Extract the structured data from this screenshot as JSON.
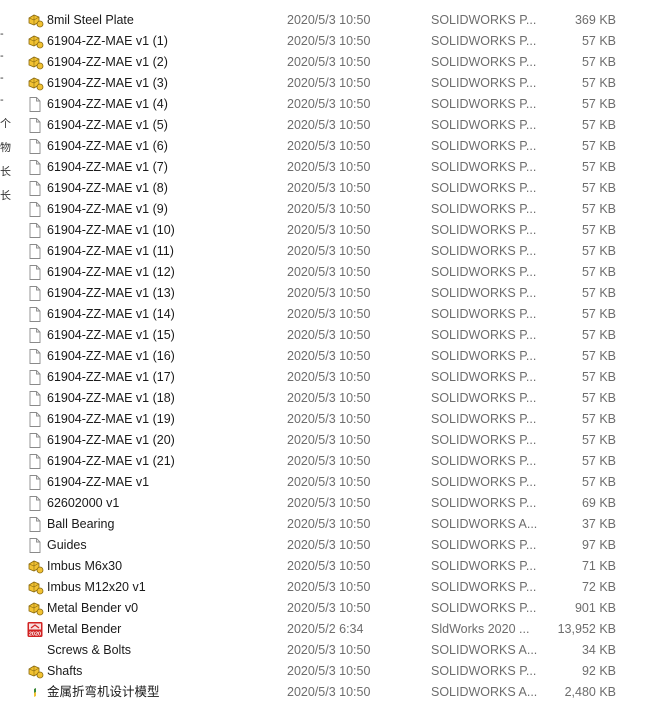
{
  "gutter_marks": [
    "-",
    "-",
    "-",
    "-",
    "个",
    "物",
    "长",
    "长"
  ],
  "files": [
    {
      "icon": "solidworks-assembly-icon",
      "name": "8mil Steel Plate",
      "date": "2020/5/3 10:50",
      "type": "SOLIDWORKS P...",
      "size": "369 KB"
    },
    {
      "icon": "solidworks-assembly-icon",
      "name": "61904-ZZ-MAE v1 (1)",
      "date": "2020/5/3 10:50",
      "type": "SOLIDWORKS P...",
      "size": "57 KB"
    },
    {
      "icon": "solidworks-assembly-icon",
      "name": "61904-ZZ-MAE v1 (2)",
      "date": "2020/5/3 10:50",
      "type": "SOLIDWORKS P...",
      "size": "57 KB"
    },
    {
      "icon": "solidworks-assembly-icon",
      "name": "61904-ZZ-MAE v1 (3)",
      "date": "2020/5/3 10:50",
      "type": "SOLIDWORKS P...",
      "size": "57 KB"
    },
    {
      "icon": "blank-file-icon",
      "name": "61904-ZZ-MAE v1 (4)",
      "date": "2020/5/3 10:50",
      "type": "SOLIDWORKS P...",
      "size": "57 KB"
    },
    {
      "icon": "blank-file-icon",
      "name": "61904-ZZ-MAE v1 (5)",
      "date": "2020/5/3 10:50",
      "type": "SOLIDWORKS P...",
      "size": "57 KB"
    },
    {
      "icon": "blank-file-icon",
      "name": "61904-ZZ-MAE v1 (6)",
      "date": "2020/5/3 10:50",
      "type": "SOLIDWORKS P...",
      "size": "57 KB"
    },
    {
      "icon": "blank-file-icon",
      "name": "61904-ZZ-MAE v1 (7)",
      "date": "2020/5/3 10:50",
      "type": "SOLIDWORKS P...",
      "size": "57 KB"
    },
    {
      "icon": "blank-file-icon",
      "name": "61904-ZZ-MAE v1 (8)",
      "date": "2020/5/3 10:50",
      "type": "SOLIDWORKS P...",
      "size": "57 KB"
    },
    {
      "icon": "blank-file-icon",
      "name": "61904-ZZ-MAE v1 (9)",
      "date": "2020/5/3 10:50",
      "type": "SOLIDWORKS P...",
      "size": "57 KB"
    },
    {
      "icon": "blank-file-icon",
      "name": "61904-ZZ-MAE v1 (10)",
      "date": "2020/5/3 10:50",
      "type": "SOLIDWORKS P...",
      "size": "57 KB"
    },
    {
      "icon": "blank-file-icon",
      "name": "61904-ZZ-MAE v1 (11)",
      "date": "2020/5/3 10:50",
      "type": "SOLIDWORKS P...",
      "size": "57 KB"
    },
    {
      "icon": "blank-file-icon",
      "name": "61904-ZZ-MAE v1 (12)",
      "date": "2020/5/3 10:50",
      "type": "SOLIDWORKS P...",
      "size": "57 KB"
    },
    {
      "icon": "blank-file-icon",
      "name": "61904-ZZ-MAE v1 (13)",
      "date": "2020/5/3 10:50",
      "type": "SOLIDWORKS P...",
      "size": "57 KB"
    },
    {
      "icon": "blank-file-icon",
      "name": "61904-ZZ-MAE v1 (14)",
      "date": "2020/5/3 10:50",
      "type": "SOLIDWORKS P...",
      "size": "57 KB"
    },
    {
      "icon": "blank-file-icon",
      "name": "61904-ZZ-MAE v1 (15)",
      "date": "2020/5/3 10:50",
      "type": "SOLIDWORKS P...",
      "size": "57 KB"
    },
    {
      "icon": "blank-file-icon",
      "name": "61904-ZZ-MAE v1 (16)",
      "date": "2020/5/3 10:50",
      "type": "SOLIDWORKS P...",
      "size": "57 KB"
    },
    {
      "icon": "blank-file-icon",
      "name": "61904-ZZ-MAE v1 (17)",
      "date": "2020/5/3 10:50",
      "type": "SOLIDWORKS P...",
      "size": "57 KB"
    },
    {
      "icon": "blank-file-icon",
      "name": "61904-ZZ-MAE v1 (18)",
      "date": "2020/5/3 10:50",
      "type": "SOLIDWORKS P...",
      "size": "57 KB"
    },
    {
      "icon": "blank-file-icon",
      "name": "61904-ZZ-MAE v1 (19)",
      "date": "2020/5/3 10:50",
      "type": "SOLIDWORKS P...",
      "size": "57 KB"
    },
    {
      "icon": "blank-file-icon",
      "name": "61904-ZZ-MAE v1 (20)",
      "date": "2020/5/3 10:50",
      "type": "SOLIDWORKS P...",
      "size": "57 KB"
    },
    {
      "icon": "blank-file-icon",
      "name": "61904-ZZ-MAE v1 (21)",
      "date": "2020/5/3 10:50",
      "type": "SOLIDWORKS P...",
      "size": "57 KB"
    },
    {
      "icon": "blank-file-icon",
      "name": "61904-ZZ-MAE v1",
      "date": "2020/5/3 10:50",
      "type": "SOLIDWORKS P...",
      "size": "57 KB"
    },
    {
      "icon": "blank-file-icon",
      "name": "62602000 v1",
      "date": "2020/5/3 10:50",
      "type": "SOLIDWORKS P...",
      "size": "69 KB"
    },
    {
      "icon": "blank-file-icon",
      "name": "Ball Bearing",
      "date": "2020/5/3 10:50",
      "type": "SOLIDWORKS A...",
      "size": "37 KB"
    },
    {
      "icon": "blank-file-icon",
      "name": "Guides",
      "date": "2020/5/3 10:50",
      "type": "SOLIDWORKS P...",
      "size": "97 KB"
    },
    {
      "icon": "solidworks-assembly-icon",
      "name": "Imbus M6x30",
      "date": "2020/5/3 10:50",
      "type": "SOLIDWORKS P...",
      "size": "71 KB"
    },
    {
      "icon": "solidworks-assembly-icon",
      "name": "Imbus M12x20 v1",
      "date": "2020/5/3 10:50",
      "type": "SOLIDWORKS P...",
      "size": "72 KB"
    },
    {
      "icon": "solidworks-assembly-icon",
      "name": "Metal Bender v0",
      "date": "2020/5/3 10:50",
      "type": "SOLIDWORKS P...",
      "size": "901 KB"
    },
    {
      "icon": "solidworks-2020-icon",
      "icon_text": "2020",
      "name": "Metal Bender",
      "date": "2020/5/2 6:34",
      "type": "SldWorks 2020 ...",
      "size": "13,952 KB"
    },
    {
      "icon": "none",
      "name": "Screws & Bolts",
      "date": "2020/5/3 10:50",
      "type": "SOLIDWORKS A...",
      "size": "34 KB"
    },
    {
      "icon": "solidworks-assembly-icon",
      "name": "Shafts",
      "date": "2020/5/3 10:50",
      "type": "SOLIDWORKS P...",
      "size": "92 KB"
    },
    {
      "icon": "solidworks-small-icon",
      "name": "金属折弯机设计模型",
      "date": "2020/5/3 10:50",
      "type": "SOLIDWORKS A...",
      "size": "2,480 KB"
    }
  ],
  "colors": {
    "text": "#1a1a1a",
    "secondary_text": "#6d6d6d",
    "icon_yellow": "#f2c232",
    "icon_outline": "#8a6a10",
    "solidworks_red": "#d12222"
  }
}
